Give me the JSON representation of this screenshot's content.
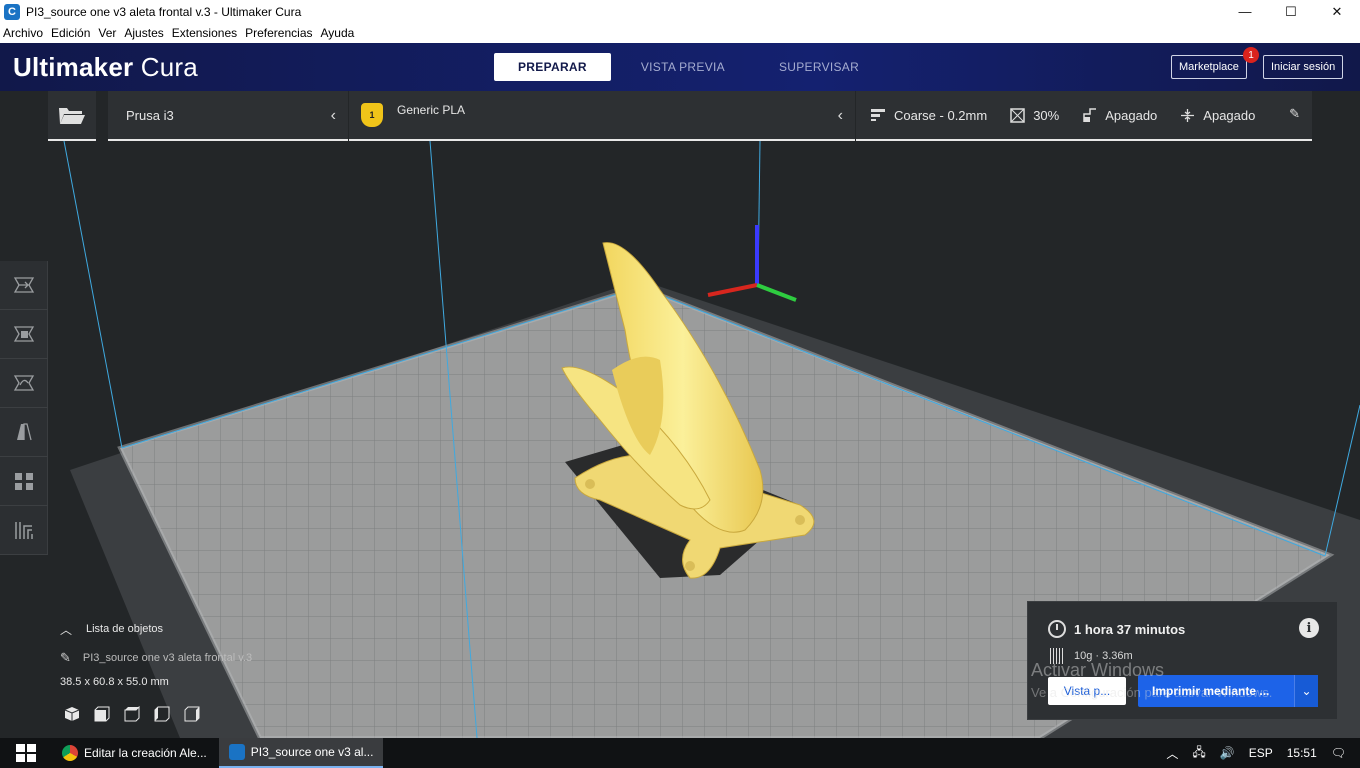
{
  "window": {
    "title": "PI3_source one v3 aleta frontal v.3 - Ultimaker Cura",
    "minimize": "—",
    "maximize": "☐",
    "close": "✕"
  },
  "menu": [
    "Archivo",
    "Edición",
    "Ver",
    "Ajustes",
    "Extensiones",
    "Preferencias",
    "Ayuda"
  ],
  "header": {
    "logo_bold": "Ultimaker",
    "logo_light": "Cura",
    "tabs": [
      "PREPARAR",
      "VISTA PREVIA",
      "SUPERVISAR"
    ],
    "active_tab": "PREPARAR",
    "marketplace": "Marketplace",
    "marketplace_badge": "1",
    "signin": "Iniciar sesión"
  },
  "toolbar": {
    "printer": "Prusa i3",
    "material": "Generic PLA",
    "material_badge": "1",
    "profile": "Coarse - 0.2mm",
    "infill": "30%",
    "support": "Apagado",
    "adhesion": "Apagado"
  },
  "objects": {
    "toggle_label": "Lista de objetos",
    "object_name": "PI3_source one v3 aleta frontal v.3",
    "dimensions": "38.5 x 60.8 x 55.0 mm"
  },
  "summary": {
    "time": "1 hora 37 minutos",
    "material_usage": "10g · 3.36m",
    "preview_button": "Vista p...",
    "print_button": "Imprimir mediante ..."
  },
  "watermark": {
    "line1": "Activar Windows",
    "line2": "Ve a Configuración para activar Windows."
  },
  "taskbar": {
    "tasks": [
      "Editar la creación Ale...",
      "PI3_source one v3 al..."
    ],
    "language": "ESP",
    "clock": "15:51"
  },
  "colors": {
    "header_bg": "#12194a",
    "accent_blue": "#1d63e8",
    "model_yellow": "#f5e27a",
    "axis_x": "#d7261e",
    "axis_y": "#2ecc40",
    "axis_z": "#3a3aff"
  }
}
